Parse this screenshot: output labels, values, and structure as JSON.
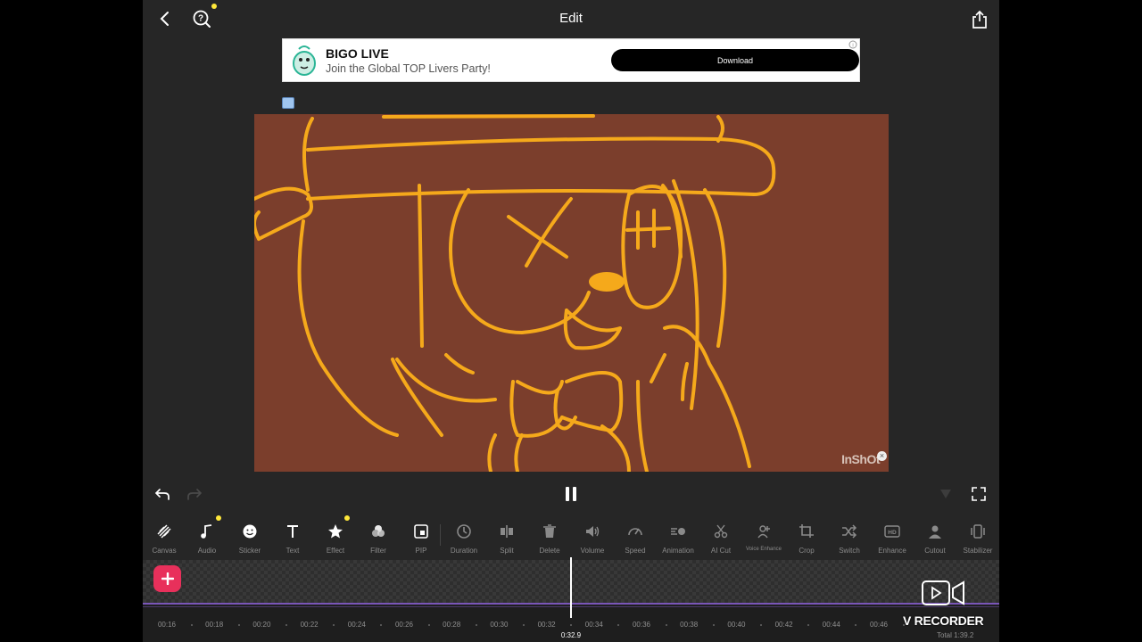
{
  "header": {
    "title": "Edit"
  },
  "ad": {
    "name": "BIGO LIVE",
    "subtitle": "Join the Global TOP Livers Party!",
    "button": "Download"
  },
  "preview": {
    "watermark": "InShOt"
  },
  "toolbar": [
    {
      "label": "Canvas",
      "icon": "canvas-icon"
    },
    {
      "label": "Audio",
      "icon": "music-note-icon",
      "dot": true
    },
    {
      "label": "Sticker",
      "icon": "smiley-icon"
    },
    {
      "label": "Text",
      "icon": "text-icon"
    },
    {
      "label": "Effect",
      "icon": "star-icon",
      "dot": true
    },
    {
      "label": "Filter",
      "icon": "filter-icon"
    },
    {
      "label": "PIP",
      "icon": "pip-icon"
    },
    {
      "label": "Duration",
      "icon": "clock-icon"
    },
    {
      "label": "Split",
      "icon": "split-icon"
    },
    {
      "label": "Delete",
      "icon": "trash-icon"
    },
    {
      "label": "Volume",
      "icon": "volume-icon"
    },
    {
      "label": "Speed",
      "icon": "speed-icon"
    },
    {
      "label": "Animation",
      "icon": "animation-icon"
    },
    {
      "label": "AI Cut",
      "icon": "scissors-icon"
    },
    {
      "label": "Voice Enhance",
      "icon": "voice-enhance-icon"
    },
    {
      "label": "Crop",
      "icon": "crop-icon"
    },
    {
      "label": "Switch",
      "icon": "shuffle-icon"
    },
    {
      "label": "Enhance",
      "icon": "hd-icon"
    },
    {
      "label": "Cutout",
      "icon": "cutout-icon"
    },
    {
      "label": "Stabilizer",
      "icon": "stabilizer-icon"
    }
  ],
  "timeline": {
    "ticks": [
      "00:16",
      "00:18",
      "00:20",
      "00:22",
      "00:24",
      "00:26",
      "00:28",
      "00:30",
      "00:32",
      "00:34",
      "00:36",
      "00:38",
      "00:40",
      "00:42",
      "00:44",
      "00:46"
    ],
    "current_time": "0:32.9",
    "total": "Total 1:39.2"
  },
  "overlay": {
    "recorder_label": "V RECORDER"
  },
  "colors": {
    "accent": "#e8305b",
    "canvas_bg": "#7b3e2c",
    "stroke": "#f5a91b",
    "notify_dot": "#ffe83a"
  }
}
